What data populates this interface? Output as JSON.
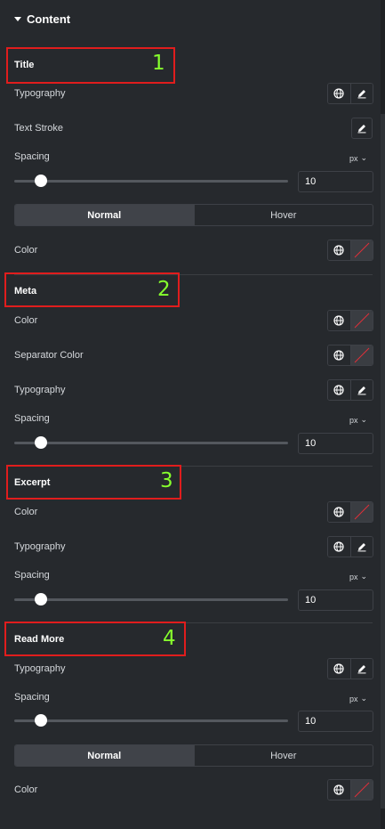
{
  "section": {
    "title": "Content"
  },
  "annotations": [
    "1",
    "2",
    "3",
    "4"
  ],
  "groups": {
    "title": {
      "heading": "Title",
      "typography": "Typography",
      "text_stroke": "Text Stroke",
      "spacing": "Spacing",
      "unit": "px",
      "spacing_value": "10",
      "tabs": [
        "Normal",
        "Hover"
      ],
      "color": "Color"
    },
    "meta": {
      "heading": "Meta",
      "color": "Color",
      "separator_color": "Separator Color",
      "typography": "Typography",
      "spacing": "Spacing",
      "unit": "px",
      "spacing_value": "10"
    },
    "excerpt": {
      "heading": "Excerpt",
      "color": "Color",
      "typography": "Typography",
      "spacing": "Spacing",
      "unit": "px",
      "spacing_value": "10"
    },
    "read_more": {
      "heading": "Read More",
      "typography": "Typography",
      "spacing": "Spacing",
      "unit": "px",
      "spacing_value": "10",
      "tabs": [
        "Normal",
        "Hover"
      ],
      "color": "Color"
    }
  },
  "colors": {
    "annotation_box": "#e01d1d",
    "annotation_number": "#86ff2d",
    "panel_bg": "#26292d"
  },
  "icons": [
    "caret-down-icon",
    "globe-icon",
    "pencil-icon",
    "no-color-swatch-icon",
    "chevron-down-icon"
  ]
}
